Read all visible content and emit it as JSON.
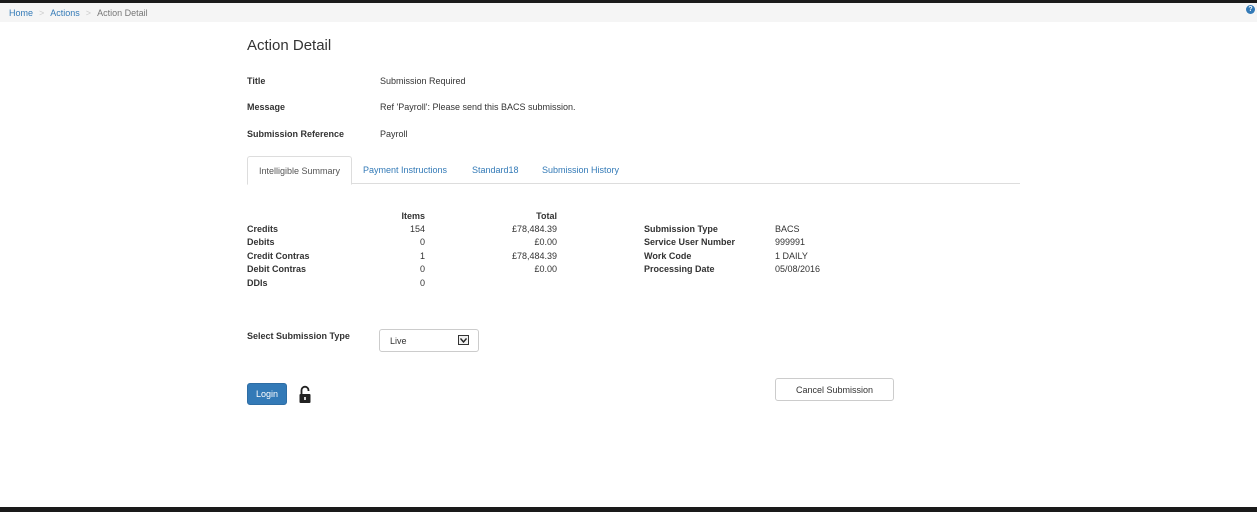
{
  "breadcrumb": {
    "home": "Home",
    "actions": "Actions",
    "current": "Action Detail",
    "separator": ">"
  },
  "help_icon": "?",
  "page_title": "Action Detail",
  "details": {
    "title_label": "Title",
    "title_value": "Submission Required",
    "message_label": "Message",
    "message_value": "Ref 'Payroll': Please send this BACS submission.",
    "reference_label": "Submission Reference",
    "reference_value": "Payroll"
  },
  "tabs": [
    {
      "label": "Intelligible Summary",
      "active": true
    },
    {
      "label": "Payment Instructions",
      "active": false
    },
    {
      "label": "Standard18",
      "active": false
    },
    {
      "label": "Submission History",
      "active": false
    }
  ],
  "summary": {
    "headers": {
      "items": "Items",
      "total": "Total"
    },
    "rows": [
      {
        "label": "Credits",
        "items": "154",
        "total": "£78,484.39"
      },
      {
        "label": "Debits",
        "items": "0",
        "total": "£0.00"
      },
      {
        "label": "Credit Contras",
        "items": "1",
        "total": "£78,484.39"
      },
      {
        "label": "Debit Contras",
        "items": "0",
        "total": "£0.00"
      },
      {
        "label": "DDIs",
        "items": "0",
        "total": ""
      }
    ]
  },
  "submission_info": [
    {
      "label": "Submission Type",
      "value": "BACS"
    },
    {
      "label": "Service User Number",
      "value": "999991"
    },
    {
      "label": "Work Code",
      "value": "1 DAILY"
    },
    {
      "label": "Processing Date",
      "value": "05/08/2016"
    }
  ],
  "select": {
    "label": "Select Submission Type",
    "value": "Live"
  },
  "buttons": {
    "login": "Login",
    "cancel": "Cancel Submission"
  },
  "colors": {
    "link": "#337ab7",
    "primary_button": "#337ab7"
  },
  "icons": {
    "help": "help-icon",
    "lock": "unlocked-padlock-icon",
    "dropdown": "chevron-down-icon"
  }
}
